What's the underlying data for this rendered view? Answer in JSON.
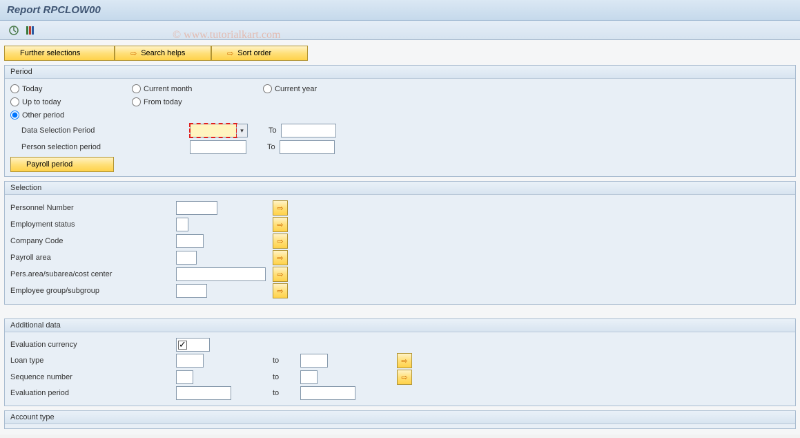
{
  "title": "Report RPCLOW00",
  "watermark": "© www.tutorialkart.com",
  "toolbar_buttons": {
    "further_selections": "Further selections",
    "search_helps": "Search helps",
    "sort_order": "Sort order"
  },
  "period": {
    "title": "Period",
    "radios": {
      "today": "Today",
      "current_month": "Current month",
      "current_year": "Current year",
      "up_to_today": "Up to today",
      "from_today": "From today",
      "other_period": "Other period"
    },
    "selected": "other_period",
    "data_selection_label": "Data Selection Period",
    "person_selection_label": "Person selection period",
    "to_label": "To",
    "payroll_period_btn": "Payroll period"
  },
  "selection": {
    "title": "Selection",
    "rows": [
      {
        "label": "Personnel Number"
      },
      {
        "label": "Employment status"
      },
      {
        "label": "Company Code"
      },
      {
        "label": "Payroll area"
      },
      {
        "label": "Pers.area/subarea/cost center"
      },
      {
        "label": "Employee group/subgroup"
      }
    ]
  },
  "additional": {
    "title": "Additional data",
    "eval_currency_label": "Evaluation currency",
    "loan_type_label": "Loan type",
    "sequence_number_label": "Sequence number",
    "evaluation_period_label": "Evaluation period",
    "to_label": "to"
  },
  "account_type": {
    "title": "Account type"
  },
  "inputs": {
    "data_sel_from": "",
    "data_sel_to": "",
    "person_sel_from": "",
    "person_sel_to": "",
    "personnel_number": "",
    "employment_status": "",
    "company_code": "",
    "payroll_area": "",
    "pers_area": "",
    "emp_group": "",
    "eval_currency": "",
    "loan_type_from": "",
    "loan_type_to": "",
    "seq_from": "",
    "seq_to": "",
    "eval_period_from": "",
    "eval_period_to": ""
  },
  "eval_currency_checked": true
}
